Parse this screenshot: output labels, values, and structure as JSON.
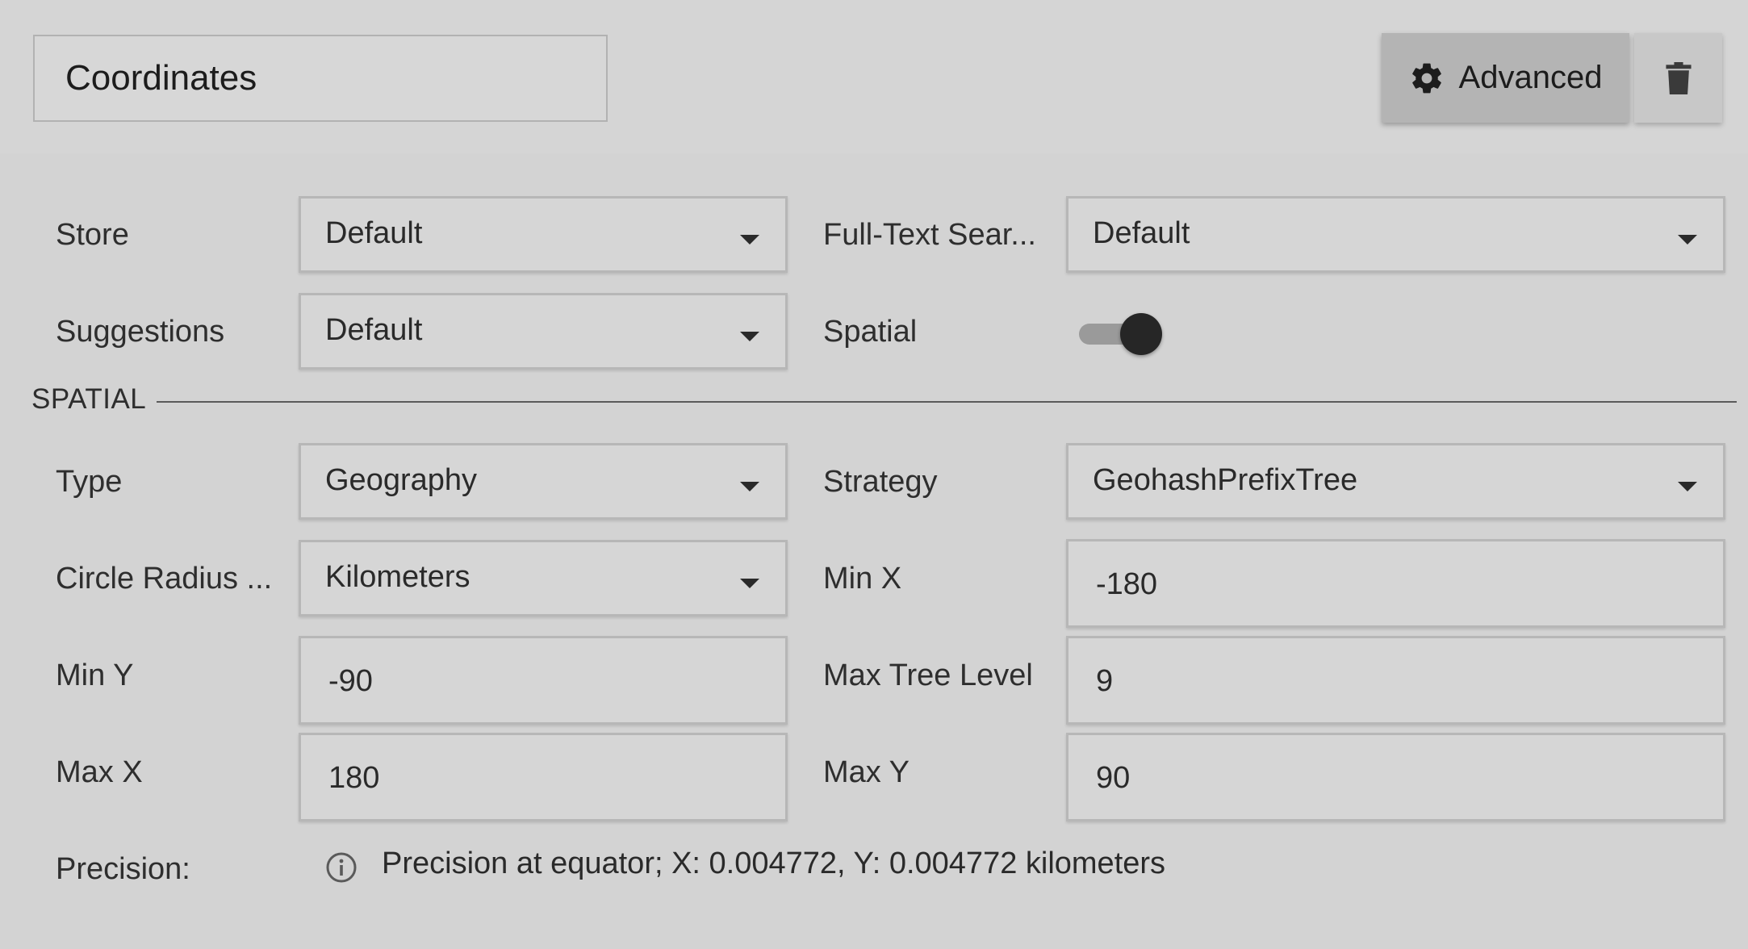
{
  "header": {
    "name_value": "Coordinates",
    "advanced_label": "Advanced",
    "advanced_icon": "gear-icon",
    "delete_icon": "trash-icon"
  },
  "fields": {
    "store": {
      "label": "Store",
      "value": "Default"
    },
    "full_text_search": {
      "label": "Full-Text Sear...",
      "value": "Default"
    },
    "suggestions": {
      "label": "Suggestions",
      "value": "Default"
    },
    "spatial": {
      "label": "Spatial",
      "enabled": true
    }
  },
  "spatial_section": {
    "title": "SPATIAL",
    "type": {
      "label": "Type",
      "value": "Geography"
    },
    "strategy": {
      "label": "Strategy",
      "value": "GeohashPrefixTree"
    },
    "circle_radius_units": {
      "label": "Circle Radius ...",
      "value": "Kilometers"
    },
    "min_x": {
      "label": "Min X",
      "value": "-180"
    },
    "min_y": {
      "label": "Min Y",
      "value": "-90"
    },
    "max_tree_level": {
      "label": "Max Tree Level",
      "value": "9"
    },
    "max_x": {
      "label": "Max X",
      "value": "180"
    },
    "max_y": {
      "label": "Max Y",
      "value": "90"
    },
    "precision": {
      "label": "Precision:",
      "icon": "info-icon",
      "text": "Precision at equator; X: 0.004772, Y: 0.004772 kilometers"
    }
  },
  "colors": {
    "background": "#d3d3d3",
    "advanced_button": "#b4b4b4",
    "toggle_thumb": "#262626",
    "toggle_track": "#9a9a9a"
  }
}
